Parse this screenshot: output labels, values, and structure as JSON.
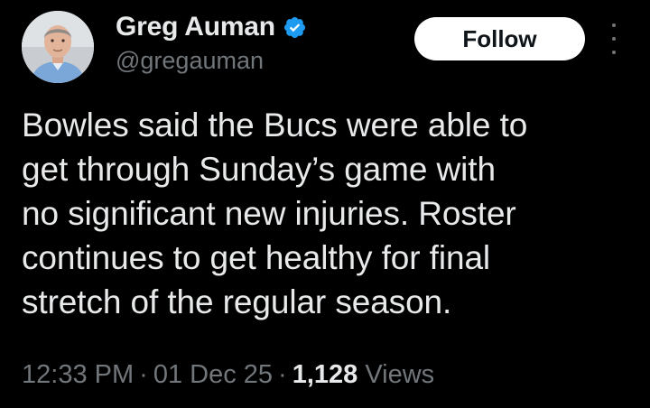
{
  "author": {
    "display_name": "Greg Auman",
    "handle": "@gregauman",
    "verified": true,
    "verified_color": "#1d9bf0"
  },
  "actions": {
    "follow_label": "Follow",
    "more_icon": "more-vertical-icon"
  },
  "tweet": {
    "text_lines": [
      "Bowles said the Bucs were able to",
      "get through Sunday’s game with",
      "no significant new injuries. Roster",
      "continues to get healthy for final",
      "stretch of the regular season."
    ]
  },
  "meta": {
    "time": "12:33 PM",
    "separator": "·",
    "date": "01 Dec 25",
    "views_count": "1,128",
    "views_label": "Views"
  },
  "colors": {
    "background": "#000000",
    "text_primary": "#e7e9ea",
    "text_secondary": "#71767b",
    "button_bg": "#ffffff",
    "button_text": "#0f1419"
  }
}
